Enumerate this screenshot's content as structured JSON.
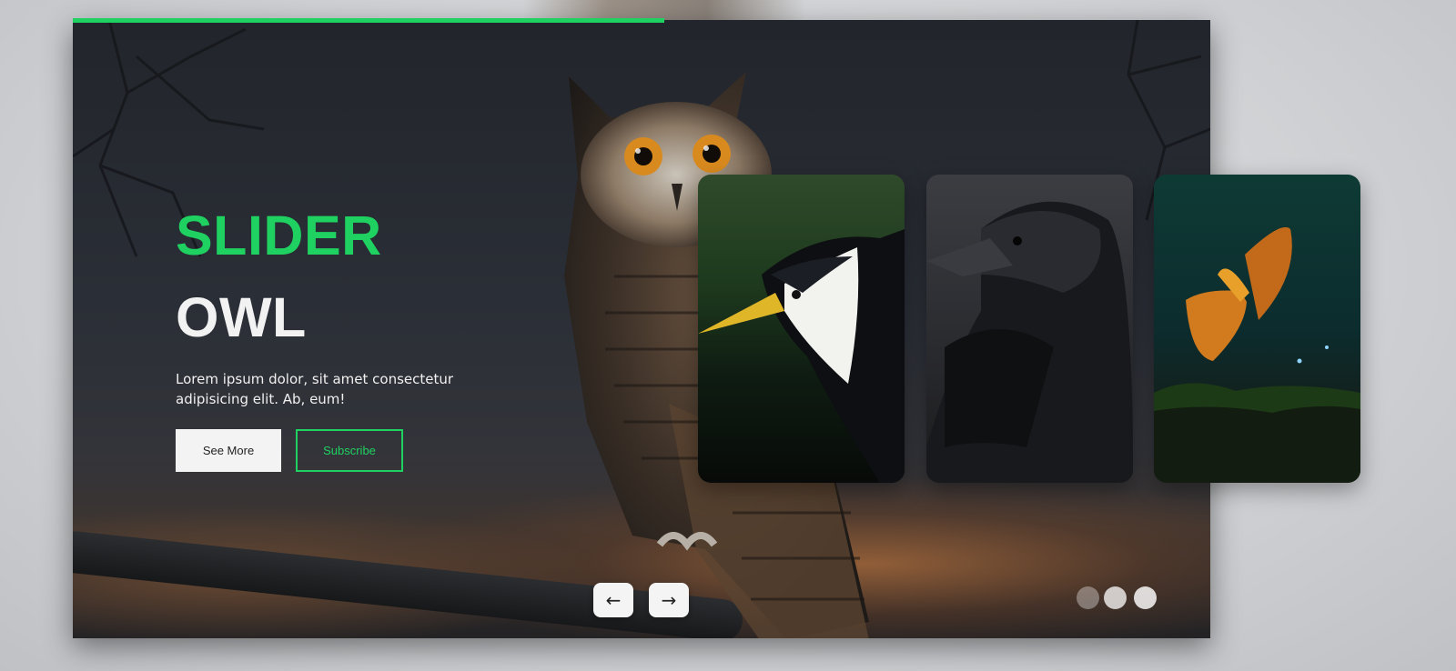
{
  "hero": {
    "title_line1": "SLIDER",
    "title_line2": "OWL",
    "description": "Lorem ipsum dolor, sit amet consectetur adipisicing elit. Ab, eum!",
    "see_more_label": "See More",
    "subscribe_label": "Subscribe"
  },
  "progress": {
    "fraction": 0.52
  },
  "thumbnails": [
    {
      "subject": "bird-with-yellow-beak"
    },
    {
      "subject": "black-crow"
    },
    {
      "subject": "butterfly"
    }
  ],
  "navigation": {
    "prev_icon": "arrow-left-icon",
    "next_icon": "arrow-right-icon",
    "prev_glyph": "←",
    "next_glyph": "→"
  },
  "colors": {
    "accent": "#1fd160",
    "title_light": "#f2f2f2",
    "button_light": "#f3f3f3"
  }
}
